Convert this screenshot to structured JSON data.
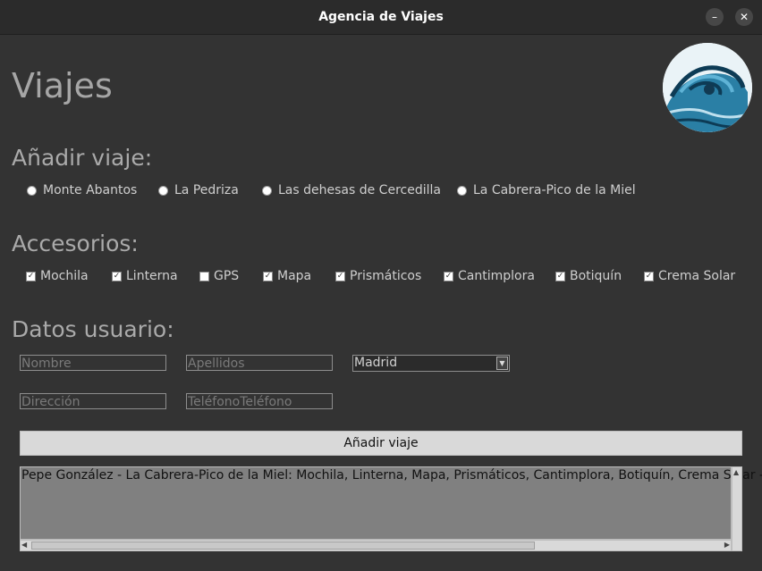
{
  "window": {
    "title": "Agencia de Viajes",
    "minimize": "–",
    "close": "✕"
  },
  "heading": "Viajes",
  "sections": {
    "add_trip": "Añadir viaje:",
    "accessories": "Accesorios:",
    "user_data": "Datos usuario:"
  },
  "routes": [
    {
      "label": "Monte Abantos"
    },
    {
      "label": "La Pedriza"
    },
    {
      "label": "Las dehesas de Cercedilla"
    },
    {
      "label": "La Cabrera-Pico de la Miel"
    }
  ],
  "accessories": [
    {
      "label": "Mochila",
      "checked": true
    },
    {
      "label": "Linterna",
      "checked": true
    },
    {
      "label": "GPS",
      "checked": false
    },
    {
      "label": "Mapa",
      "checked": true
    },
    {
      "label": "Prismáticos",
      "checked": true
    },
    {
      "label": "Cantimplora",
      "checked": true
    },
    {
      "label": "Botiquín",
      "checked": true
    },
    {
      "label": "Crema Solar",
      "checked": true
    }
  ],
  "form": {
    "nombre": "Nombre",
    "apellidos": "Apellidos",
    "ciudad": "Madrid",
    "direccion": "Dirección",
    "telefono": "TeléfonoTeléfono"
  },
  "button": "Añadir viaje",
  "output": "Pepe González - La Cabrera-Pico de la Miel: Mochila, Linterna, Mapa, Prismáticos, Cantimplora, Botiquín, Crema Solar -- D",
  "colors": {
    "background": "#333333",
    "titlebar": "#2b2b2b",
    "button": "#d9d9d9",
    "textarea": "#808080"
  }
}
